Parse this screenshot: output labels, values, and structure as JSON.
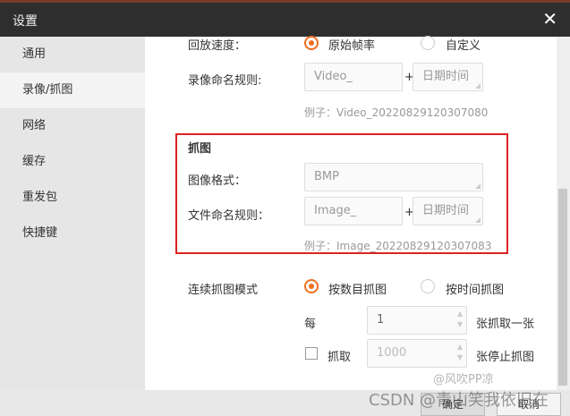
{
  "window": {
    "title": "设置",
    "close": "✕"
  },
  "sidebar": {
    "items": [
      {
        "label": "通用"
      },
      {
        "label": "录像/抓图",
        "active": true
      },
      {
        "label": "网络"
      },
      {
        "label": "缓存"
      },
      {
        "label": "重发包"
      },
      {
        "label": "快捷键"
      }
    ]
  },
  "record": {
    "speed_label": "回放速度：",
    "speed_options": [
      "原始帧率",
      "自定义"
    ],
    "name_rule_label": "录像命名规则:",
    "prefix": "Video_",
    "plus": "+",
    "suffix": "日期时间",
    "example": "例子：Video_20220829120307080"
  },
  "capture": {
    "title": "抓图",
    "format_label": "图像格式：",
    "format": "BMP",
    "name_rule_label": "文件命名规则：",
    "prefix": "Image_",
    "plus": "+",
    "suffix": "日期时间",
    "example": "例子：Image_20220829120307083"
  },
  "continuous": {
    "label": "连续抓图模式",
    "options": [
      "按数目抓图",
      "按时间抓图"
    ],
    "every_label": "每",
    "every_value": "1",
    "every_unit": "张抓取一张",
    "stop_label": "抓取",
    "stop_value": "1000",
    "stop_unit": "张停止抓图",
    "stop_checked": false
  },
  "footer": {
    "ok": "确定",
    "cancel": "取消"
  },
  "watermarks": {
    "w1": "@风吹PP凉",
    "w2": "CSDN @青山笑我依旧在"
  },
  "colors": {
    "accent": "#f07020",
    "highlight": "#dd2222"
  }
}
